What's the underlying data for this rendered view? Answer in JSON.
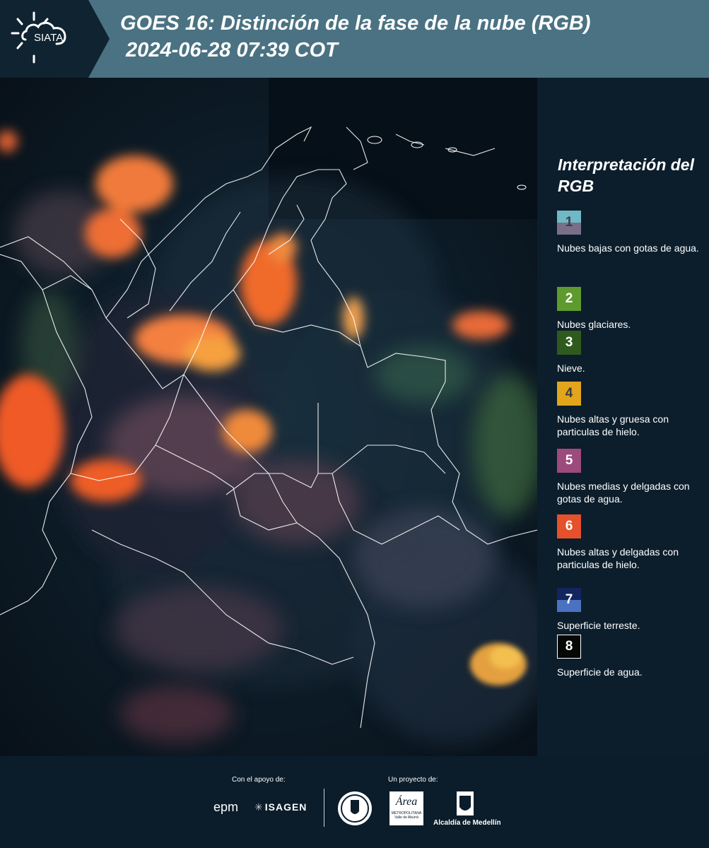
{
  "header": {
    "logo_text": "SIATA",
    "title_line1": "GOES 16: Distinción de la fase de la nube (RGB)",
    "title_line2": " 2024-06-28 07:39 COT"
  },
  "legend": {
    "title": "Interpretación del RGB",
    "items": [
      {
        "number": "1",
        "label": "Nubes bajas con gotas de agua.",
        "color_top": "#6fb9c6",
        "color_bottom": "#7a6f8a",
        "number_color": "#3b3b4a"
      },
      {
        "number": "2",
        "label": "Nubes glaciares.",
        "color_top": "#5f9a2e",
        "color_bottom": "#5f9a2e",
        "number_color": "#ffffff"
      },
      {
        "number": "3",
        "label": "Nieve.",
        "color_top": "#2f5a1e",
        "color_bottom": "#2f5a1e",
        "number_color": "#ffffff"
      },
      {
        "number": "4",
        "label": "Nubes altas y gruesa con particulas de hielo.",
        "color_top": "#e2a51c",
        "color_bottom": "#e2a51c",
        "number_color": "#3b3b3b"
      },
      {
        "number": "5",
        "label": "Nubes medias y delgadas con gotas de agua.",
        "color_top": "#9d4a7c",
        "color_bottom": "#9d4a7c",
        "number_color": "#ffffff"
      },
      {
        "number": "6",
        "label": "Nubes altas y delgadas con particulas de hielo.",
        "color_top": "#e4512a",
        "color_bottom": "#e4512a",
        "number_color": "#ffffff"
      },
      {
        "number": "7",
        "label": "Superficie terreste.",
        "color_top": "#12255e",
        "color_bottom": "#4a72c0",
        "number_color": "#ffffff"
      },
      {
        "number": "8",
        "label": "Superficie de agua.",
        "color_top": "#050805",
        "color_bottom": "#050805",
        "number_color": "#ffffff"
      }
    ]
  },
  "footer": {
    "support_label": "Con el apoyo de:",
    "project_label": "Un proyecto de:",
    "partner_epm": "epm",
    "partner_isagen": "ISAGEN",
    "partner_area": "Área",
    "partner_area_sub1": "METROPOLITANA",
    "partner_area_sub2": "Valle de Aburrá",
    "partner_alcaldia": "Alcaldía de Medellín"
  },
  "colors": {
    "header_bg": "#4a7282",
    "logo_bg": "#0f2331",
    "legend_bg": "#0c1e2c",
    "cloud_orange": "#f36b2a",
    "cloud_yellow": "#e0b030",
    "cloud_pink": "#a0647e",
    "border_white": "#ffffff"
  }
}
